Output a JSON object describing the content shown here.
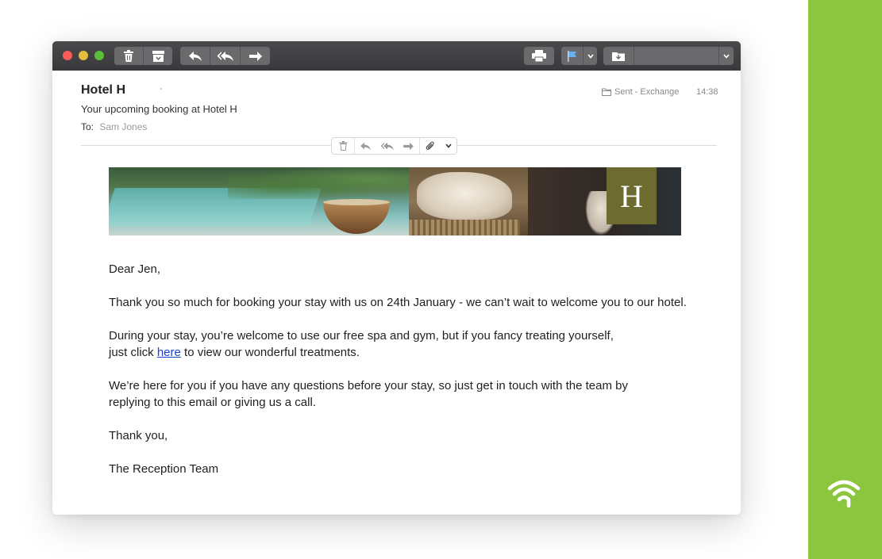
{
  "email": {
    "sender": "Hotel H",
    "subject": "Your upcoming booking at Hotel H",
    "to_label": "To:",
    "to_name": "Sam Jones",
    "folder": "Sent - Exchange",
    "time": "14:38"
  },
  "banner": {
    "logo_letter": "H"
  },
  "body": {
    "greeting": "Dear Jen,",
    "para1": "Thank you so much for booking your stay with us on 24th January - we can’t wait to welcome you to our hotel.",
    "para2_line1": "During your stay, you’re welcome to use our free spa and gym, but if you fancy treating yourself,",
    "para2_prefix": "just click ",
    "para2_link": "here",
    "para2_suffix": " to view our wonderful treatments.",
    "para3_line1": "We’re here for you if you have any questions before your stay, so just get in touch with the team by",
    "para3_line2": "replying to this email or giving us a call.",
    "closing": "Thank you,",
    "signature": "The Reception Team"
  },
  "colors": {
    "accent_green": "#8cc63f",
    "logo_olive": "#6d6b2f",
    "link_blue": "#1a3fd6"
  },
  "icons": {
    "toolbar": [
      "trash-icon",
      "archive-icon",
      "reply-icon",
      "reply-all-icon",
      "forward-icon",
      "print-icon",
      "flag-icon",
      "move-to-folder-icon"
    ],
    "inline": [
      "trash-icon",
      "reply-icon",
      "reply-all-icon",
      "forward-icon",
      "attachment-icon",
      "chevron-down-icon"
    ],
    "brand": "wifi-logo-icon"
  }
}
